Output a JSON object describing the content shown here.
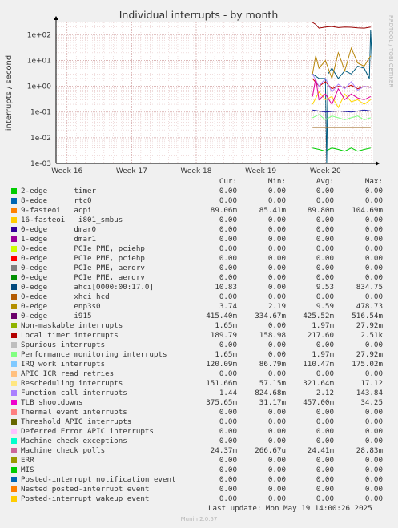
{
  "header": {
    "title": "Individual interrupts - by month",
    "side_label": "RRDTOOL / TOBI OETIKER"
  },
  "chart_data": {
    "type": "line",
    "title": "Individual interrupts - by month",
    "ylabel": "interrupts / second",
    "yscale": "log",
    "ylim": [
      0.001,
      300
    ],
    "y_ticks": [
      "1e+02",
      "1e+01",
      "1e+00",
      "1e-01",
      "1e-02",
      "1e-03"
    ],
    "y_tick_values": [
      100,
      10,
      1,
      0.1,
      0.01,
      0.001
    ],
    "x_ticks": [
      "Week 16",
      "Week 17",
      "Week 18",
      "Week 19",
      "Week 20"
    ],
    "x_tick_values": [
      16,
      17,
      18,
      19,
      20
    ],
    "xlim": [
      15.83,
      20.74
    ],
    "grid": true,
    "series": [
      {
        "name": "timer",
        "color": "#00cc00",
        "x": [
          19.8,
          19.9,
          20.0,
          20.1,
          20.2,
          20.3,
          20.4,
          20.5,
          20.6,
          20.7
        ],
        "values": [
          0.004,
          0.0035,
          0.003,
          0.004,
          0.0035,
          0.003,
          0.004,
          0.003,
          0.0035,
          0.004
        ]
      },
      {
        "name": "ahci[0000:00:17.0]",
        "color": "#005a7d",
        "x": [
          19.8,
          19.9,
          20.0,
          20.02,
          20.04,
          20.1,
          20.2,
          20.3,
          20.4,
          20.5,
          20.6,
          20.68,
          20.7,
          20.72
        ],
        "values": [
          3,
          2,
          2,
          0.001,
          3,
          5,
          2,
          4,
          3,
          6,
          5,
          2,
          150,
          10
        ]
      },
      {
        "name": "i915",
        "color": "#990000",
        "x": [
          19.8,
          19.85,
          19.9,
          20.0,
          20.1,
          20.2,
          20.3,
          20.4,
          20.5,
          20.6,
          20.7
        ],
        "values": [
          300,
          250,
          180,
          200,
          210,
          190,
          200,
          195,
          185,
          180,
          200
        ]
      },
      {
        "name": "Local timer interrupts",
        "color": "#cc0000",
        "x": [
          19.8,
          19.9,
          20.0,
          20.1,
          20.2,
          20.3,
          20.4,
          20.5,
          20.6,
          20.7
        ],
        "values": [
          2,
          1,
          1.5,
          0.8,
          1,
          0.9,
          1.1,
          0.8,
          1,
          0.9
        ]
      },
      {
        "name": "enp3s0",
        "color": "#b8860b",
        "x": [
          19.8,
          19.85,
          19.9,
          20.0,
          20.1,
          20.2,
          20.3,
          20.4,
          20.5,
          20.6,
          20.7
        ],
        "values": [
          3,
          15,
          5,
          10,
          2,
          20,
          4,
          30,
          8,
          6,
          15
        ]
      },
      {
        "name": "Function call interrupts",
        "color": "#aa88ff",
        "x": [
          19.8,
          19.9,
          20.0,
          20.1,
          20.2,
          20.3,
          20.4,
          20.5,
          20.6,
          20.7
        ],
        "values": [
          3,
          1,
          2,
          0.6,
          1.2,
          0.8,
          1.5,
          0.7,
          1,
          0.9
        ]
      },
      {
        "name": "Rescheduling interrupts",
        "color": "#ffd700",
        "x": [
          19.8,
          19.9,
          20.0,
          20.1,
          20.2,
          20.3,
          20.4,
          20.5,
          20.6,
          20.7
        ],
        "values": [
          0.2,
          0.6,
          0.3,
          0.4,
          0.15,
          0.5,
          0.25,
          0.3,
          0.2,
          0.3
        ]
      },
      {
        "name": "TLB shootdowns",
        "color": "#e0009e",
        "x": [
          19.8,
          19.85,
          19.9,
          20.0,
          20.1,
          20.2,
          20.3,
          20.4,
          20.5,
          20.6,
          20.7
        ],
        "values": [
          0.4,
          2,
          0.3,
          0.5,
          0.2,
          0.8,
          0.3,
          0.5,
          0.35,
          0.3,
          0.4
        ]
      },
      {
        "name": "Performance monitoring interrupts",
        "color": "#80ff80",
        "x": [
          19.8,
          19.9,
          20.0,
          20.1,
          20.2,
          20.3,
          20.4,
          20.5,
          20.6,
          20.7
        ],
        "values": [
          0.06,
          0.08,
          0.05,
          0.07,
          0.06,
          0.05,
          0.06,
          0.07,
          0.05,
          0.06
        ]
      },
      {
        "name": "Machine check polls",
        "color": "#aa7a3c",
        "x": [
          19.8,
          20.7
        ],
        "values": [
          0.025,
          0.025
        ]
      },
      {
        "name": "dmar0",
        "color": "#1a1aa8",
        "x": [
          19.8,
          20.0,
          20.2,
          20.4,
          20.6,
          20.7
        ],
        "values": [
          0.12,
          0.1,
          0.11,
          0.1,
          0.12,
          0.11
        ]
      }
    ]
  },
  "legend": {
    "headers": {
      "cur": "Cur:",
      "min": "Min:",
      "avg": "Avg:",
      "max": "Max:"
    },
    "rows": [
      {
        "label": "2-edge      timer",
        "color": "#00cc00",
        "cur": "0.00",
        "min": "0.00",
        "avg": "0.00",
        "max": "0.00"
      },
      {
        "label": "8-edge      rtc0",
        "color": "#0066b3",
        "cur": "0.00",
        "min": "0.00",
        "avg": "0.00",
        "max": "0.00"
      },
      {
        "label": "9-fasteoi   acpi",
        "color": "#ff8000",
        "cur": "89.06m",
        "min": "85.41m",
        "avg": "89.80m",
        "max": "104.69m"
      },
      {
        "label": "16-fasteoi   i801_smbus",
        "color": "#ffcc00",
        "cur": "0.00",
        "min": "0.00",
        "avg": "0.00",
        "max": "0.00"
      },
      {
        "label": "0-edge      dmar0",
        "color": "#330099",
        "cur": "0.00",
        "min": "0.00",
        "avg": "0.00",
        "max": "0.00"
      },
      {
        "label": "1-edge      dmar1",
        "color": "#990099",
        "cur": "0.00",
        "min": "0.00",
        "avg": "0.00",
        "max": "0.00"
      },
      {
        "label": "0-edge      PCIe PME, pciehp",
        "color": "#ccff00",
        "cur": "0.00",
        "min": "0.00",
        "avg": "0.00",
        "max": "0.00"
      },
      {
        "label": "0-edge      PCIe PME, pciehp",
        "color": "#ff0000",
        "cur": "0.00",
        "min": "0.00",
        "avg": "0.00",
        "max": "0.00"
      },
      {
        "label": "0-edge      PCIe PME, aerdrv",
        "color": "#808080",
        "cur": "0.00",
        "min": "0.00",
        "avg": "0.00",
        "max": "0.00"
      },
      {
        "label": "0-edge      PCIe PME, aerdrv",
        "color": "#008f00",
        "cur": "0.00",
        "min": "0.00",
        "avg": "0.00",
        "max": "0.00"
      },
      {
        "label": "0-edge      ahci[0000:00:17.0]",
        "color": "#00487d",
        "cur": "10.83",
        "min": "0.00",
        "avg": "9.53",
        "max": "834.75"
      },
      {
        "label": "0-edge      xhci_hcd",
        "color": "#b35a00",
        "cur": "0.00",
        "min": "0.00",
        "avg": "0.00",
        "max": "0.00"
      },
      {
        "label": "0-edge      enp3s0",
        "color": "#b38f00",
        "cur": "3.74",
        "min": "2.19",
        "avg": "9.59",
        "max": "478.73"
      },
      {
        "label": "0-edge      i915",
        "color": "#6b006b",
        "cur": "415.40m",
        "min": "334.67m",
        "avg": "425.52m",
        "max": "516.54m"
      },
      {
        "label": "Non-maskable interrupts",
        "color": "#8fb300",
        "cur": "1.65m",
        "min": "0.00",
        "avg": "1.97m",
        "max": "27.92m"
      },
      {
        "label": "Local timer interrupts",
        "color": "#b30000",
        "cur": "189.79",
        "min": "158.98",
        "avg": "217.60",
        "max": "2.51k"
      },
      {
        "label": "Spurious interrupts",
        "color": "#bebebe",
        "cur": "0.00",
        "min": "0.00",
        "avg": "0.00",
        "max": "0.00"
      },
      {
        "label": "Performance monitoring interrupts",
        "color": "#80ff80",
        "cur": "1.65m",
        "min": "0.00",
        "avg": "1.97m",
        "max": "27.92m"
      },
      {
        "label": "IRQ work interrupts",
        "color": "#80c9ff",
        "cur": "120.09m",
        "min": "86.79m",
        "avg": "110.47m",
        "max": "175.02m"
      },
      {
        "label": "APIC ICR read retries",
        "color": "#ffc080",
        "cur": "0.00",
        "min": "0.00",
        "avg": "0.00",
        "max": "0.00"
      },
      {
        "label": "Rescheduling interrupts",
        "color": "#ffe680",
        "cur": "151.66m",
        "min": "57.15m",
        "avg": "321.64m",
        "max": "17.12"
      },
      {
        "label": "Function call interrupts",
        "color": "#aa80ff",
        "cur": "1.44",
        "min": "824.68m",
        "avg": "2.12",
        "max": "143.84"
      },
      {
        "label": "TLB shootdowns",
        "color": "#ee00cc",
        "cur": "375.65m",
        "min": "31.17m",
        "avg": "457.00m",
        "max": "34.25"
      },
      {
        "label": "Thermal event interrupts",
        "color": "#ff8080",
        "cur": "0.00",
        "min": "0.00",
        "avg": "0.00",
        "max": "0.00"
      },
      {
        "label": "Threshold APIC interrupts",
        "color": "#666600",
        "cur": "0.00",
        "min": "0.00",
        "avg": "0.00",
        "max": "0.00"
      },
      {
        "label": "Deferred Error APIC interrupts",
        "color": "#ffbfff",
        "cur": "0.00",
        "min": "0.00",
        "avg": "0.00",
        "max": "0.00"
      },
      {
        "label": "Machine check exceptions",
        "color": "#00ffcc",
        "cur": "0.00",
        "min": "0.00",
        "avg": "0.00",
        "max": "0.00"
      },
      {
        "label": "Machine check polls",
        "color": "#cc6699",
        "cur": "24.37m",
        "min": "266.67u",
        "avg": "24.41m",
        "max": "28.83m"
      },
      {
        "label": "ERR",
        "color": "#999900",
        "cur": "0.00",
        "min": "0.00",
        "avg": "0.00",
        "max": "0.00"
      },
      {
        "label": "MIS",
        "color": "#00cc00",
        "cur": "0.00",
        "min": "0.00",
        "avg": "0.00",
        "max": "0.00"
      },
      {
        "label": "Posted-interrupt notification event",
        "color": "#0066b3",
        "cur": "0.00",
        "min": "0.00",
        "avg": "0.00",
        "max": "0.00"
      },
      {
        "label": "Nested posted-interrupt event",
        "color": "#ff8000",
        "cur": "0.00",
        "min": "0.00",
        "avg": "0.00",
        "max": "0.00"
      },
      {
        "label": "Posted-interrupt wakeup event",
        "color": "#ffcc00",
        "cur": "0.00",
        "min": "0.00",
        "avg": "0.00",
        "max": "0.00"
      }
    ]
  },
  "footer": {
    "last_update": "Last update: Mon May 19 14:00:26 2025",
    "munin_version": "Munin 2.0.57"
  }
}
